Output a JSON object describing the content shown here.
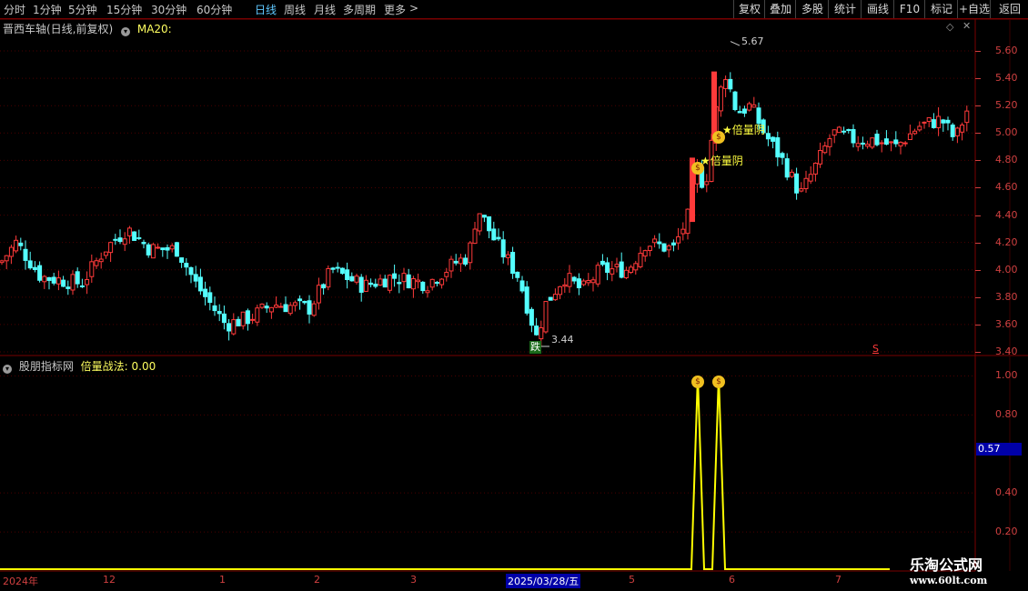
{
  "toolbar": {
    "periods": [
      "分时",
      "1分钟",
      "5分钟",
      "15分钟",
      "30分钟",
      "60分钟",
      "日线",
      "周线",
      "月线",
      "多周期",
      "更多"
    ],
    "active_period": "日线",
    "more_arrow": ">",
    "buttons": [
      "复权",
      "叠加",
      "多股",
      "统计",
      "画线",
      "F10",
      "标记",
      "+自选",
      "返回"
    ]
  },
  "main_panel": {
    "title": "晋西车轴(日线,前复权)",
    "indicator": "MA20:",
    "high_label": "5.67",
    "low_label": "3.44",
    "drop_badge": "跌",
    "signal_text_1": "★倍量阴",
    "signal_text_2": "★倍量阴",
    "s_marker": "S",
    "y_ticks": [
      "5.60",
      "5.40",
      "5.20",
      "5.00",
      "4.80",
      "4.60",
      "4.40",
      "4.20",
      "4.00",
      "3.80",
      "3.60",
      "3.40"
    ]
  },
  "sub_panel": {
    "title": "股朋指标网",
    "indicator": "倍量战法: 0.00",
    "y_ticks": [
      "1.00",
      "0.80",
      "0.40",
      "0.20"
    ],
    "current_value": "0.57"
  },
  "x_axis": {
    "labels": [
      "2024年",
      "12",
      "1",
      "2",
      "3",
      "2025/03/28/五",
      "5",
      "6",
      "7"
    ]
  },
  "watermark": {
    "line1": "乐淘公式网",
    "line2": "www.60lt.com"
  },
  "colors": {
    "up": "#ff3a3a",
    "down": "#54ffff",
    "axis": "#d04040",
    "signal": "#ffff00",
    "active": "#5fc8ff"
  },
  "chart_data": {
    "type": "candlestick",
    "price_range": [
      3.38,
      5.72
    ],
    "high": 5.67,
    "low": 3.44,
    "sub_indicator_range": [
      0,
      1.1
    ],
    "sub_indicator_peaks": [
      1.0,
      1.0
    ]
  }
}
